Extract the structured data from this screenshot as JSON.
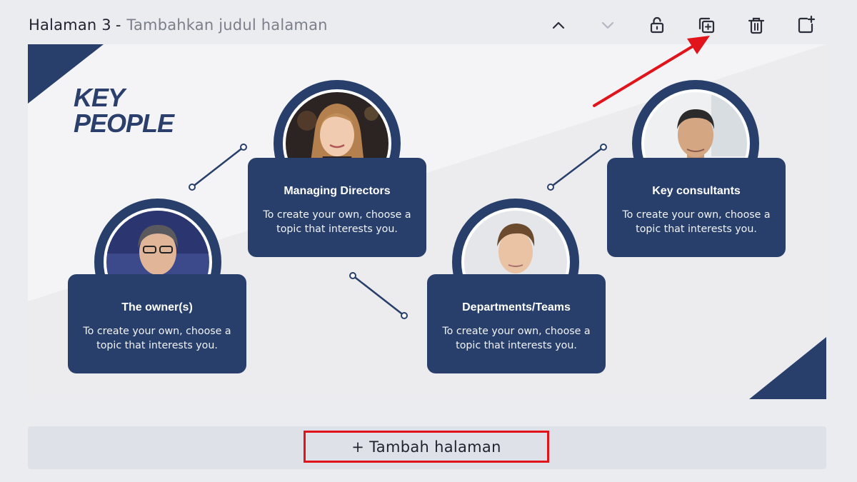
{
  "header": {
    "page_label": "Halaman 3",
    "separator": "-",
    "title_placeholder": "Tambahkan judul halaman"
  },
  "toolbar": {
    "items": [
      {
        "name": "move-up",
        "icon": "chevron-up-icon"
      },
      {
        "name": "move-down",
        "icon": "chevron-down-icon"
      },
      {
        "name": "lock",
        "icon": "unlock-icon"
      },
      {
        "name": "duplicate",
        "icon": "duplicate-page-icon"
      },
      {
        "name": "delete",
        "icon": "trash-icon"
      },
      {
        "name": "add",
        "icon": "add-page-icon"
      }
    ]
  },
  "slide": {
    "title_line1": "KEY",
    "title_line2": "PEOPLE",
    "cards": [
      {
        "title": "Managing Directors",
        "desc": "To create your own, choose a topic that interests you."
      },
      {
        "title": "Key consultants",
        "desc": "To create your own, choose a topic that interests you."
      },
      {
        "title": "The owner(s)",
        "desc": "To create your own, choose a topic that interests you."
      },
      {
        "title": "Departments/Teams",
        "desc": "To create your own, choose a topic that interests you."
      }
    ]
  },
  "footer": {
    "add_page_label": "+ Tambah halaman"
  },
  "colors": {
    "navy": "#273f6a",
    "highlight_red": "#e0141a",
    "background": "#ebecf0"
  }
}
